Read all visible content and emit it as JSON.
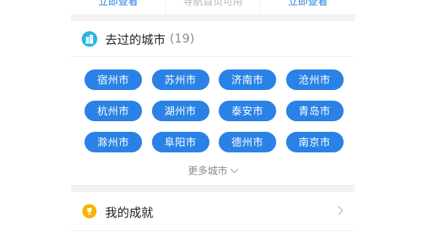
{
  "top_row": {
    "items": [
      {
        "label": "立即查看",
        "style": "link"
      },
      {
        "label": "导航首页可用",
        "style": "muted"
      },
      {
        "label": "立即查看",
        "style": "link"
      }
    ]
  },
  "cities": {
    "title": "去过的城市",
    "count": "(19)",
    "icon": "city-building-icon",
    "list": [
      "宿州市",
      "苏州市",
      "济南市",
      "沧州市",
      "杭州市",
      "湖州市",
      "泰安市",
      "青岛市",
      "滁州市",
      "阜阳市",
      "德州市",
      "南京市"
    ],
    "more_label": "更多城市"
  },
  "achievements": {
    "label": "我的成就",
    "icon": "trophy-icon"
  },
  "colors": {
    "accent": "#2b82e6",
    "city_icon": "#27b6e6",
    "trophy": "#f4b400"
  }
}
